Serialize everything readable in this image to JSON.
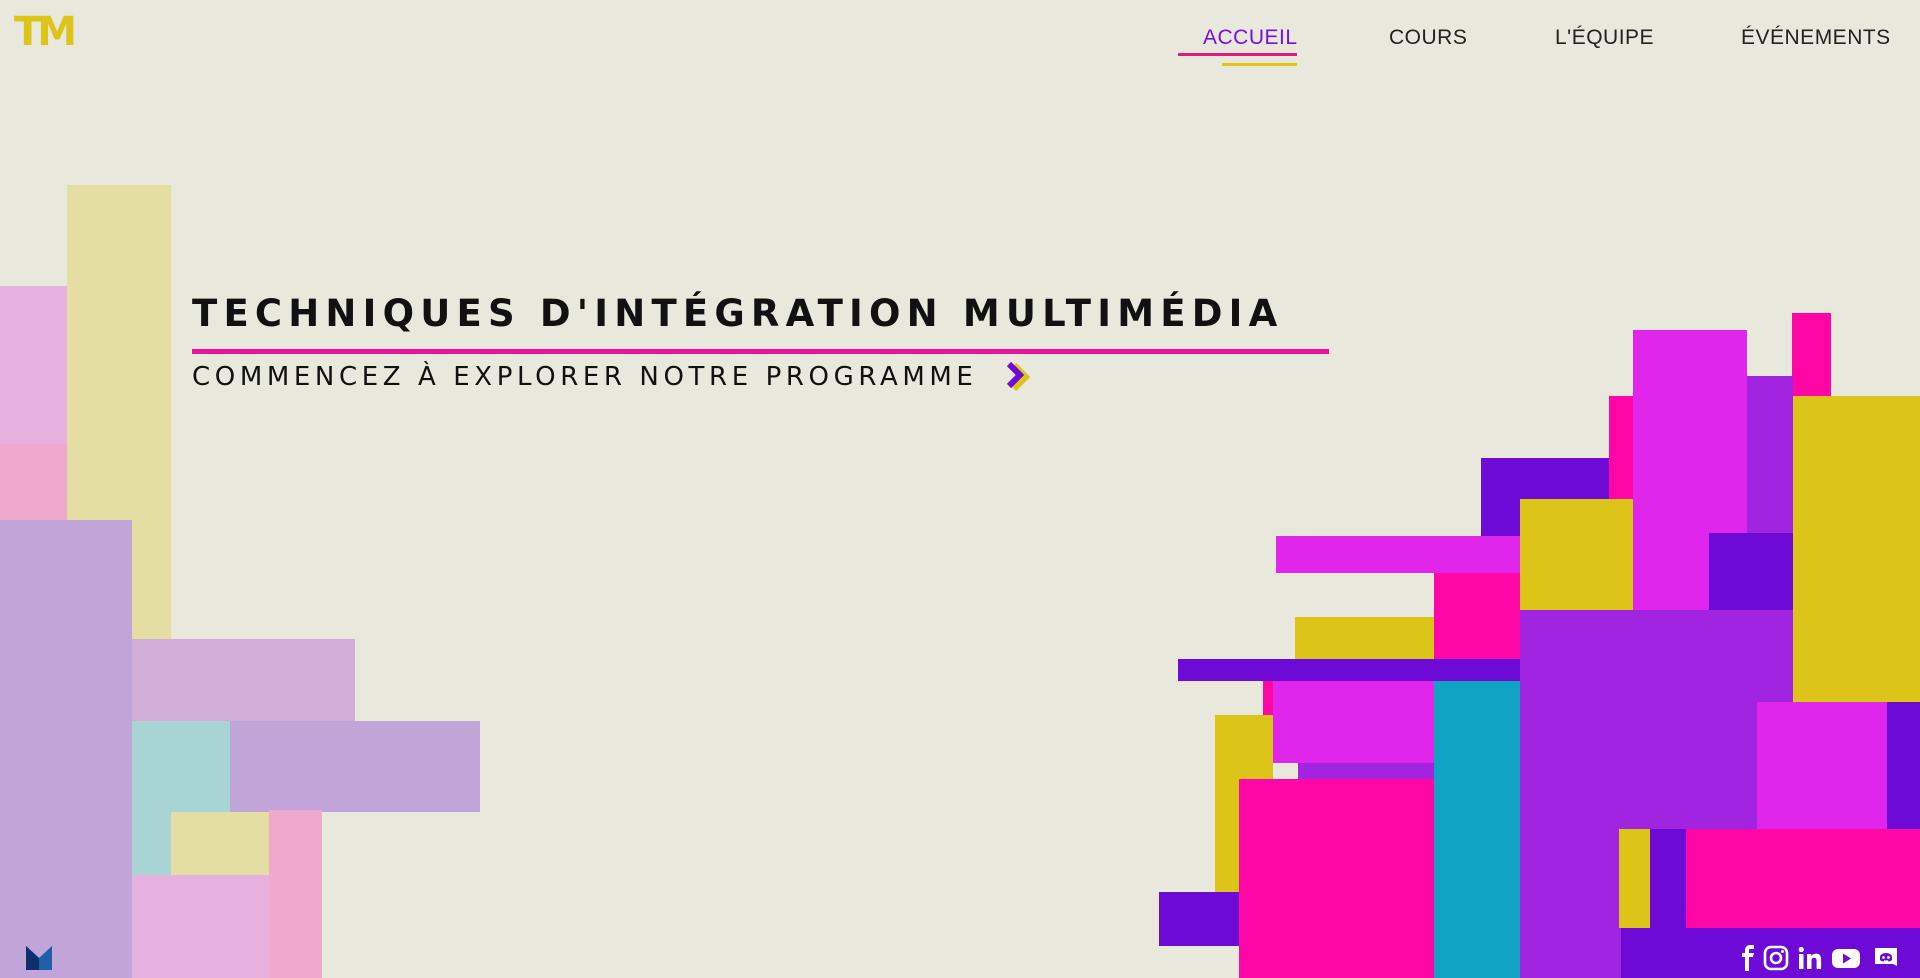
{
  "brand": {
    "logo_text": "TM",
    "color": "#ddc418"
  },
  "nav": {
    "items": [
      {
        "label": "ACCUEIL",
        "active": true
      },
      {
        "label": "COURS",
        "active": false
      },
      {
        "label": "L'ÉQUIPE",
        "active": false
      },
      {
        "label": "ÉVÉNEMENTS",
        "active": false
      }
    ],
    "active_color": "#7a10dc"
  },
  "hero": {
    "title": "TECHNIQUES D'INTÉGRATION MULTIMÉDIA",
    "subtitle": "COMMENCEZ À EXPLORER NOTRE PROGRAMME",
    "accent_line_color": "#e8119e",
    "cta_icon": "double-chevron-right-icon"
  },
  "footer": {
    "badge_icon": "m-logo-icon",
    "social_icons": [
      "facebook-icon",
      "instagram-icon",
      "linkedin-icon",
      "youtube-icon",
      "discord-icon"
    ]
  },
  "palette": {
    "pink": "#ff07a6",
    "magenta": "#e126ec",
    "purple": "#a125e0",
    "violet": "#6d0ad6",
    "yellow": "#ddc418",
    "teal": "#10a4c4",
    "background": "#e8e8dc"
  }
}
